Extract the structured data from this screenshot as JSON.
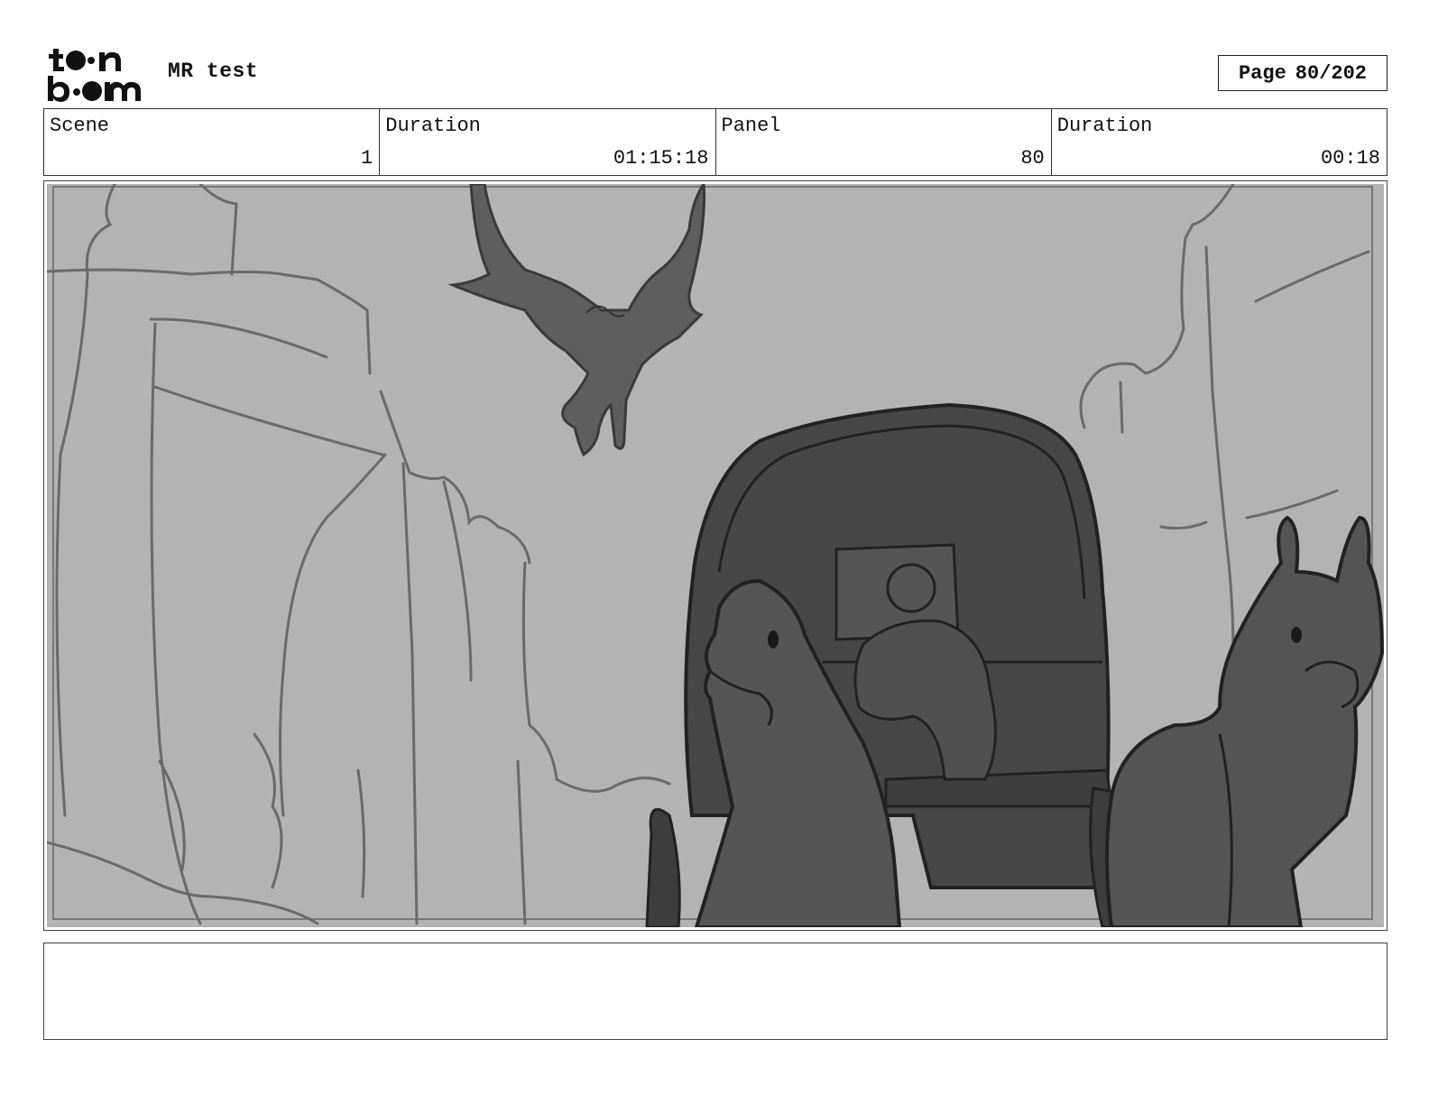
{
  "header": {
    "logo_alt": "toon boom",
    "project_title": "MR test",
    "page_label": "Page",
    "page_number": "80/202"
  },
  "info": {
    "scene_label": "Scene",
    "scene_value": "1",
    "scene_duration_label": "Duration",
    "scene_duration_value": "01:15:18",
    "panel_label": "Panel",
    "panel_value": "80",
    "panel_duration_label": "Duration",
    "panel_duration_value": "00:18"
  },
  "notes": {
    "text": ""
  },
  "colors": {
    "sky": "#b3b3b3",
    "ink": "#2b2b2b",
    "dark_fill": "#474747",
    "mid_fill": "#5e5e5e"
  }
}
